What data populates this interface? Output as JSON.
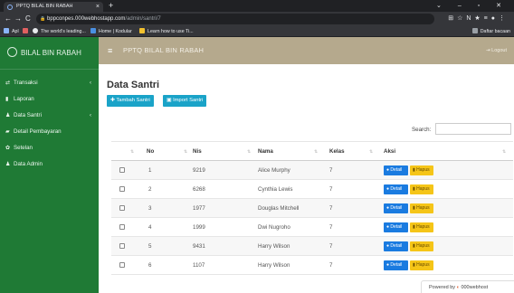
{
  "browser": {
    "tab_title": "PPTQ BILAL BIN RABAH",
    "tab_close": "×",
    "new_tab": "+",
    "window_controls": "⌄ – ▫ ✕",
    "url_host": "bppconpes.000webhostapp.com",
    "url_path": "/admin/santri/7",
    "bookmarks": [
      {
        "label": "Apl",
        "icon": "apps-icon",
        "color": "#8ab4f8"
      },
      {
        "label": "",
        "icon": "mail-icon",
        "color": "#e06060"
      },
      {
        "label": "The world's leading...",
        "icon": "github-icon",
        "color": "#e8eaed"
      },
      {
        "label": "Home | Kodular",
        "icon": "kodular-icon",
        "color": "#4a90e2"
      },
      {
        "label": "Learn how to use Ti...",
        "icon": "bookmark-icon",
        "color": "#f2c12e"
      }
    ],
    "reading_list": "Daftar bacaan"
  },
  "sidebar": {
    "brand": "BILAL BIN RABAH",
    "items": [
      {
        "label": "Transaksi",
        "icon": "transfer-icon",
        "has_chevron": true
      },
      {
        "label": "Laporan",
        "icon": "file-icon",
        "has_chevron": false
      },
      {
        "label": "Data Santri",
        "icon": "users-icon",
        "has_chevron": true
      },
      {
        "label": "Detail Pembayaran",
        "icon": "money-icon",
        "has_chevron": false
      },
      {
        "label": "Setelan",
        "icon": "gears-icon",
        "has_chevron": false
      },
      {
        "label": "Data Admin",
        "icon": "user-group-icon",
        "has_chevron": false
      }
    ]
  },
  "topbar": {
    "title": "PPTQ BILAL BIN RABAH",
    "logout": "Logout"
  },
  "main": {
    "page_title": "Data Santri",
    "btn_add": "Tambah Santri",
    "btn_import": "Import Santri",
    "search_label": "Search:",
    "search_value": "",
    "columns": [
      "No",
      "Nis",
      "Nama",
      "Kelas",
      "Aksi"
    ],
    "rows": [
      {
        "no": "1",
        "nis": "9219",
        "nama": "Alice Murphy",
        "kelas": "7"
      },
      {
        "no": "2",
        "nis": "6268",
        "nama": "Cynthia Lewis",
        "kelas": "7"
      },
      {
        "no": "3",
        "nis": "1977",
        "nama": "Douglas Mitchell",
        "kelas": "7"
      },
      {
        "no": "4",
        "nis": "1999",
        "nama": "Dwi Nugroho",
        "kelas": "7"
      },
      {
        "no": "5",
        "nis": "9431",
        "nama": "Harry Wilson",
        "kelas": "7"
      },
      {
        "no": "6",
        "nis": "1107",
        "nama": "Harry Wilson",
        "kelas": "7"
      }
    ],
    "btn_detail": "Detail",
    "btn_hapus": "Hapus"
  },
  "footer": {
    "powered_by": "Powered by",
    "host": "000webhost"
  },
  "colors": {
    "sidebar": "#1f7a35",
    "topbar": "#b5a98d",
    "primary": "#1aa3c8",
    "detail": "#1a7be0",
    "hapus": "#f5c518"
  }
}
